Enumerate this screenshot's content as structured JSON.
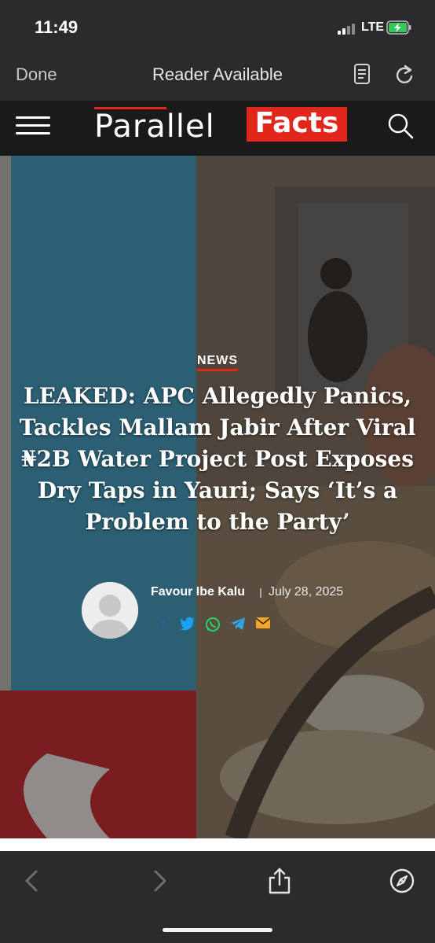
{
  "status_bar": {
    "time": "11:49",
    "network": "LTE"
  },
  "browser": {
    "done_label": "Done",
    "title": "Reader Available"
  },
  "site": {
    "logo_left": "Parallel",
    "logo_right": "Facts"
  },
  "article": {
    "category": "NEWS",
    "headline": "LEAKED: APC Allegedly Panics, Tackles Mallam Jabir After Viral ₦2B Water Project Post Exposes Dry Taps in Yauri; Says ‘It’s a Problem to the Party’",
    "author": "Favour Ibe Kalu",
    "date": "July 28, 2025",
    "share_icons": [
      "facebook-icon",
      "twitter-icon",
      "whatsapp-icon",
      "telegram-icon",
      "email-icon"
    ]
  },
  "colors": {
    "brand_red": "#e1261c",
    "facebook": "#3b5998",
    "twitter": "#1da1f2",
    "whatsapp": "#25d366",
    "telegram": "#2ca5e0",
    "email": "#f5a623"
  }
}
